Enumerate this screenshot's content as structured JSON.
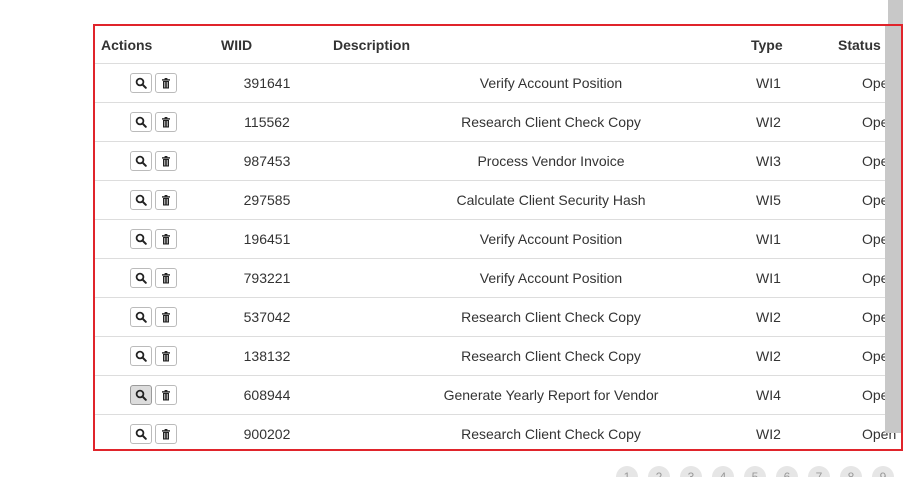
{
  "table": {
    "columns": {
      "actions": "Actions",
      "wiid": "WIID",
      "description": "Description",
      "type": "Type",
      "status": "Status"
    },
    "rows": [
      {
        "wiid": "391641",
        "description": "Verify Account Position",
        "type": "WI1",
        "status": "Ope"
      },
      {
        "wiid": "115562",
        "description": "Research Client Check Copy",
        "type": "WI2",
        "status": "Ope"
      },
      {
        "wiid": "987453",
        "description": "Process Vendor Invoice",
        "type": "WI3",
        "status": "Ope"
      },
      {
        "wiid": "297585",
        "description": "Calculate Client Security Hash",
        "type": "WI5",
        "status": "Ope"
      },
      {
        "wiid": "196451",
        "description": "Verify Account Position",
        "type": "WI1",
        "status": "Ope"
      },
      {
        "wiid": "793221",
        "description": "Verify Account Position",
        "type": "WI1",
        "status": "Ope"
      },
      {
        "wiid": "537042",
        "description": "Research Client Check Copy",
        "type": "WI2",
        "status": "Ope"
      },
      {
        "wiid": "138132",
        "description": "Research Client Check Copy",
        "type": "WI2",
        "status": "Ope"
      },
      {
        "wiid": "608944",
        "description": "Generate Yearly Report for Vendor",
        "type": "WI4",
        "status": "Ope",
        "view_active": true
      },
      {
        "wiid": "900202",
        "description": "Research Client Check Copy",
        "type": "WI2",
        "status": "Open"
      }
    ]
  },
  "icons": {
    "view": "magnifier-icon",
    "delete": "trash-icon"
  },
  "pagination": {
    "pages": [
      "1",
      "2",
      "3",
      "4",
      "5",
      "6",
      "7",
      "8",
      "9"
    ]
  },
  "colors": {
    "highlight_border": "#e0242b",
    "scrollbar": "#c8c8c8"
  }
}
